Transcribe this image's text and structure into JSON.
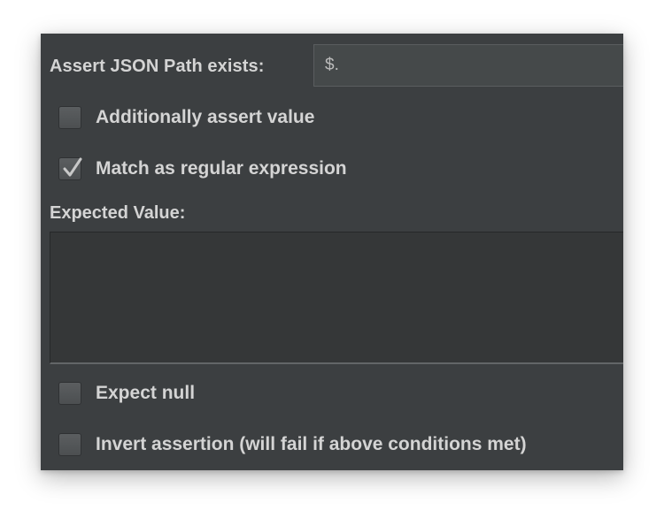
{
  "json_path": {
    "label": "Assert JSON Path exists:",
    "value": "$."
  },
  "options": {
    "additionally_assert_value": {
      "label": "Additionally assert value",
      "checked": false
    },
    "match_as_regex": {
      "label": "Match as regular expression",
      "checked": true
    },
    "expect_null": {
      "label": "Expect null",
      "checked": false
    },
    "invert_assertion": {
      "label": "Invert assertion (will fail if above conditions met)",
      "checked": false
    }
  },
  "expected_value": {
    "label": "Expected Value:",
    "value": ""
  },
  "colors": {
    "panel_background": "#3c3f41",
    "text": "#d4d4d4",
    "input_background": "#45494a",
    "checkmark": "#c8c8c8"
  },
  "icons": {
    "checkmark": "checkmark-icon"
  }
}
